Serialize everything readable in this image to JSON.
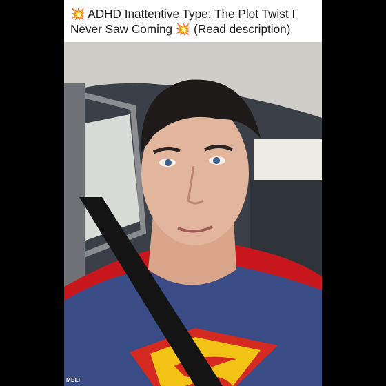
{
  "post": {
    "caption": "💥 ADHD Inattentive Type: The Plot Twist I\nNever Saw Coming 💥 (Read description)",
    "watermark": "MELF"
  },
  "colors": {
    "letterbox": "#000000",
    "caption_bg": "#ffffff",
    "cape_red": "#c8161d",
    "suit_blue": "#3a4c86"
  }
}
